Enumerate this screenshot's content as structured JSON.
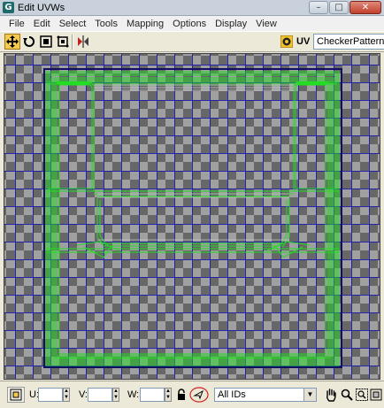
{
  "window": {
    "title": "Edit UVWs",
    "app_icon_letter": "G",
    "minimize": "–",
    "maximize": "□",
    "close": "✕"
  },
  "menu": {
    "items": [
      "File",
      "Edit",
      "Select",
      "Tools",
      "Mapping",
      "Options",
      "Display",
      "View"
    ]
  },
  "toolbar": {
    "tools": [
      "move-icon",
      "rotate-icon",
      "scale-icon",
      "freeform-icon",
      "mirror-icon"
    ],
    "active_tool": "move-icon",
    "uv_label": "UV",
    "texture_selected": "CheckerPattern  ( C"
  },
  "bottom": {
    "u_label": "U:",
    "v_label": "V:",
    "w_label": "W:",
    "u_value": "",
    "v_value": "",
    "w_value": "",
    "ids_selected": "All IDs",
    "icons": [
      "lock-icon",
      "absolute-offset-icon",
      "pan-hand-icon",
      "zoom-icon",
      "zoom-region-icon",
      "zoom-extents-icon"
    ]
  },
  "colors": {
    "grid": "#1a1ab0",
    "uv_wire": "#22dd22",
    "checker_light": "#a0a0a0",
    "checker_dark": "#676767",
    "active_tool": "#f5c94f"
  }
}
